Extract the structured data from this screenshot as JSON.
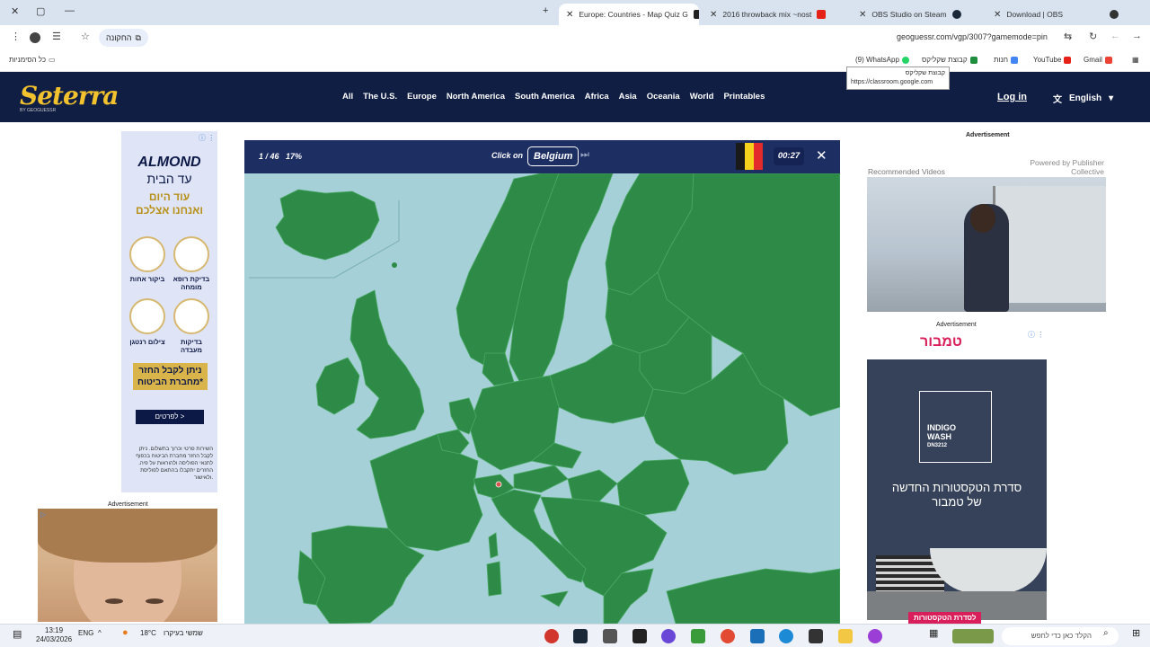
{
  "browser": {
    "tabs": [
      {
        "title": "Europe: Countries - Map Quiz G",
        "active": true
      },
      {
        "title": "2016 throwback mix ~nost",
        "active": false
      },
      {
        "title": "OBS Studio on Steam",
        "active": false
      },
      {
        "title": "Download | OBS",
        "active": false
      }
    ],
    "new_tab": "+",
    "chip_label": "החקונה",
    "url": "geoguessr.com/vgp/3007?gamemode=pin",
    "bookmarks": [
      {
        "label": "(9) WhatsApp"
      },
      {
        "label": "קבוצת שקליקס"
      },
      {
        "label": "חנות"
      },
      {
        "label": "YouTube"
      },
      {
        "label": "Gmail"
      }
    ],
    "all_bookmarks": "כל הסימניות",
    "tooltip_title": "קבוצת שקליקס",
    "tooltip_url": "https://classroom.google.com"
  },
  "site": {
    "logo": "Seterra",
    "logo_sub": "BY GEOGUESSR",
    "nav": [
      "All",
      "The U.S.",
      "Europe",
      "North America",
      "South America",
      "Africa",
      "Asia",
      "Oceania",
      "World",
      "Printables"
    ],
    "login": "Log in",
    "language": "English"
  },
  "quiz": {
    "progress": "1 / 46",
    "percent": "17%",
    "click_on": "Click on",
    "target": "Belgium",
    "timer": "00:27",
    "flag_colors": [
      "#1a1a1a",
      "#f7d21d",
      "#e42b2b"
    ]
  },
  "ad_left": {
    "brand": "ALMOND",
    "line1": "עד הבית",
    "line2": "עוד היום",
    "line3": "ואנחנו אצלכם",
    "items": [
      "בדיקת רופא מומחה",
      "ביקור אחות",
      "בדיקות מעבדה",
      "צילום רנטגן"
    ],
    "gold": "ניתן לקבל החזר מחברת הביטוח*",
    "button": "לפרטים >",
    "fine": "השירות פרטי וכרוך בתשלום. ניתן לקבל החזר מחברת הביטוח בכפוף לתנאי הפוליסה ולהוראות על פיה. החזרים יתקבלו בהתאם לפוליסת ולאישור.",
    "label_bottom": "Advertisement"
  },
  "ad_right": {
    "label_top": "Advertisement",
    "recommended": "Recommended Videos",
    "powered": "Powered by Publisher Collective",
    "label_mid": "Advertisement",
    "tamboor_logo": "טמבור",
    "box_text_1": "INDIGO",
    "box_text_2": "WASH",
    "box_text_3": "DN3212",
    "heb": "סדרת הטקסטורות החדשה של טמבור",
    "button": "לסדרת הטקסטורות"
  },
  "taskbar": {
    "time": "13:19",
    "date": "24/03/2026",
    "lang": "ENG",
    "weather": "18°C",
    "weather_text": "שמשי בעיקרו",
    "search": "הקלד כאן כדי לחפש"
  },
  "colors": {
    "land": "#2e8b47",
    "sea": "#a5d0d7",
    "header": "#101e44",
    "quizbar": "#1d2e63"
  }
}
